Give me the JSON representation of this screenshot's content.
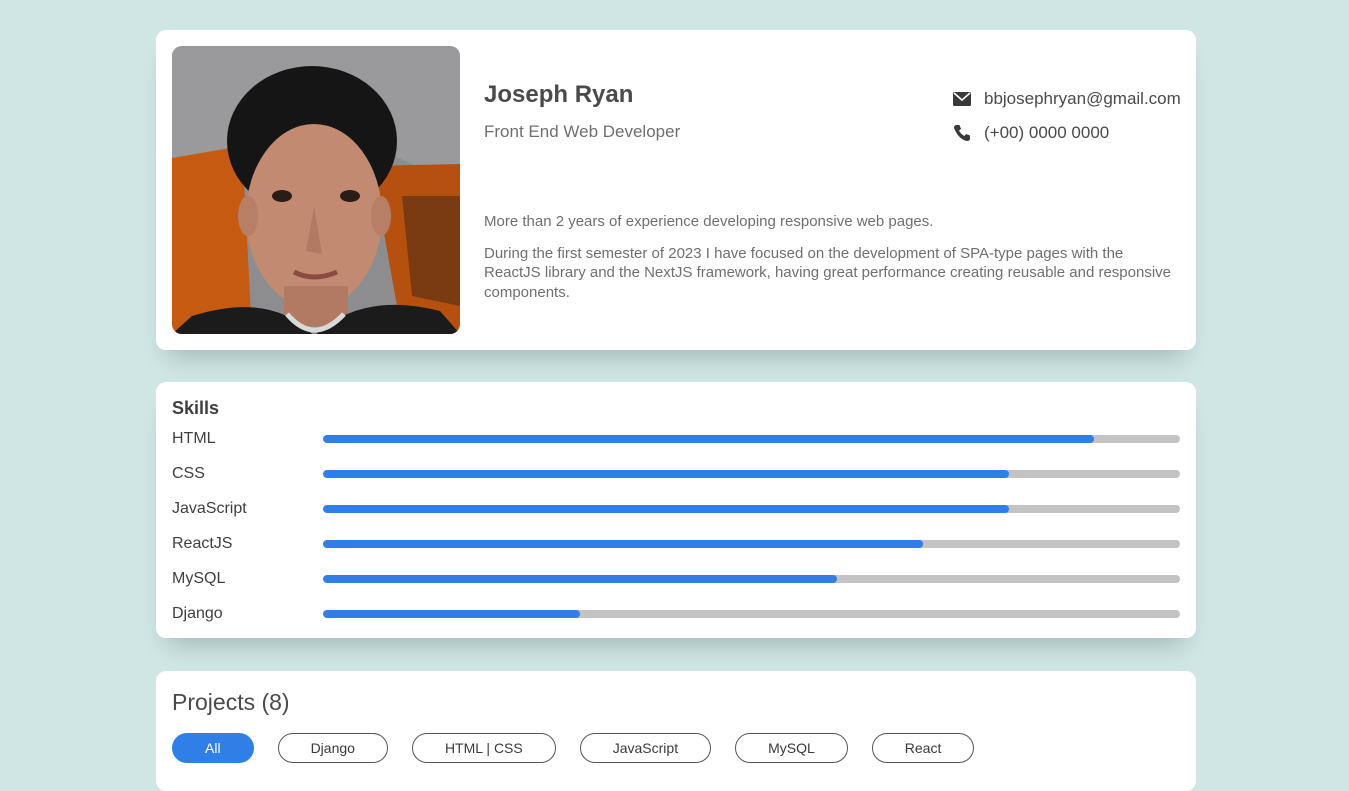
{
  "profile": {
    "name": "Joseph Ryan",
    "role": "Front End Web Developer",
    "email": "bbjosephryan@gmail.com",
    "phone": "(+00) 0000 0000",
    "summary": [
      "More than 2 years of experience developing responsive web pages.",
      "During the first semester of 2023 I have focused on the development of SPA-type pages with the ReactJS library and the NextJS framework, having great performance creating reusable and responsive components."
    ]
  },
  "skills": {
    "title": "Skills",
    "items": [
      {
        "label": "HTML",
        "level": 0.9
      },
      {
        "label": "CSS",
        "level": 0.8
      },
      {
        "label": "JavaScript",
        "level": 0.8
      },
      {
        "label": "ReactJS",
        "level": 0.7
      },
      {
        "label": "MySQL",
        "level": 0.6
      },
      {
        "label": "Django",
        "level": 0.3
      }
    ]
  },
  "projects": {
    "title": "Projects (8)",
    "filters": [
      "All",
      "Django",
      "HTML | CSS",
      "JavaScript",
      "MySQL",
      "React"
    ],
    "active_filter": "All"
  },
  "colors": {
    "background": "#cfe6e5",
    "accent": "#2f7fe6",
    "track": "#c3c3c3"
  }
}
